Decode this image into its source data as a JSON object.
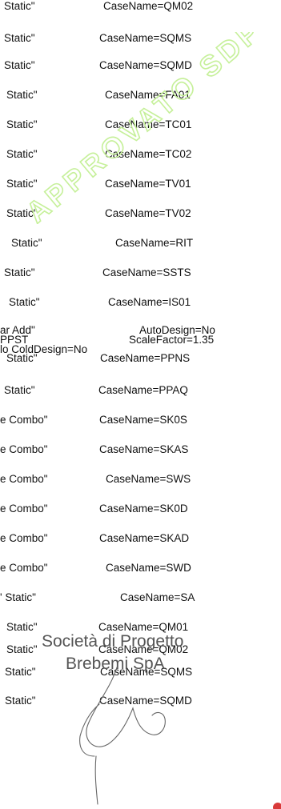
{
  "rows": [
    {
      "c1": "Static\"",
      "c2": "CaseName=QM02"
    },
    {
      "c1": "Static\"",
      "c2": "CaseName=SQMS"
    },
    {
      "c1": "Static\"",
      "c2": "CaseName=SQMD"
    },
    {
      "c1": "Static\"",
      "c2": "CaseName=FA01"
    },
    {
      "c1": "Static\"",
      "c2": "CaseName=TC01"
    },
    {
      "c1": "Static\"",
      "c2": "CaseName=TC02"
    },
    {
      "c1": "Static\"",
      "c2": "CaseName=TV01"
    },
    {
      "c1": "Static\"",
      "c2": "CaseName=TV02"
    },
    {
      "c1": "Static\"",
      "c2": "CaseName=RIT"
    },
    {
      "c1": "Static\"",
      "c2": "CaseName=SSTS"
    },
    {
      "c1": "Static\"",
      "c2": "CaseName=IS01"
    },
    {
      "c1a": "ar  Add\"",
      "c2a": "AutoDesign=No",
      "c1b": "PPST",
      "c2b": "ScaleFactor=1.35",
      "c1c": "lo  ColdDesign=No",
      "c1d": "Static\"",
      "c2d": "CaseName=PPNS"
    },
    {
      "c1": "Static\"",
      "c2": "CaseName=PPAQ"
    },
    {
      "c1": "e  Combo\"",
      "c2": "CaseName=SK0S"
    },
    {
      "c1": "e  Combo\"",
      "c2": "CaseName=SKAS"
    },
    {
      "c1": "e  Combo\"",
      "c2": "CaseName=SWS"
    },
    {
      "c1": "e  Combo\"",
      "c2": "CaseName=SK0D"
    },
    {
      "c1": "e  Combo\"",
      "c2": "CaseName=SKAD"
    },
    {
      "c1": "e  Combo\"",
      "c2": "CaseName=SWD"
    },
    {
      "c1": "'  Static\"",
      "c2": "CaseName=SA"
    },
    {
      "c1": "Static\"",
      "c2": "CaseName=QM01"
    },
    {
      "c1": "Static\"",
      "c2": "CaseName=QM02"
    },
    {
      "c1": "Static\"",
      "c2": "CaseName=SQMS"
    },
    {
      "c1": "Static\"",
      "c2": "CaseName=SQMD"
    }
  ],
  "watermark": {
    "text": "APPROVATO SDP",
    "color": "#c6f09a"
  },
  "seal": {
    "line1": "Società di Progetto",
    "line2": "Brebemi SpA",
    "color": "#555555"
  }
}
